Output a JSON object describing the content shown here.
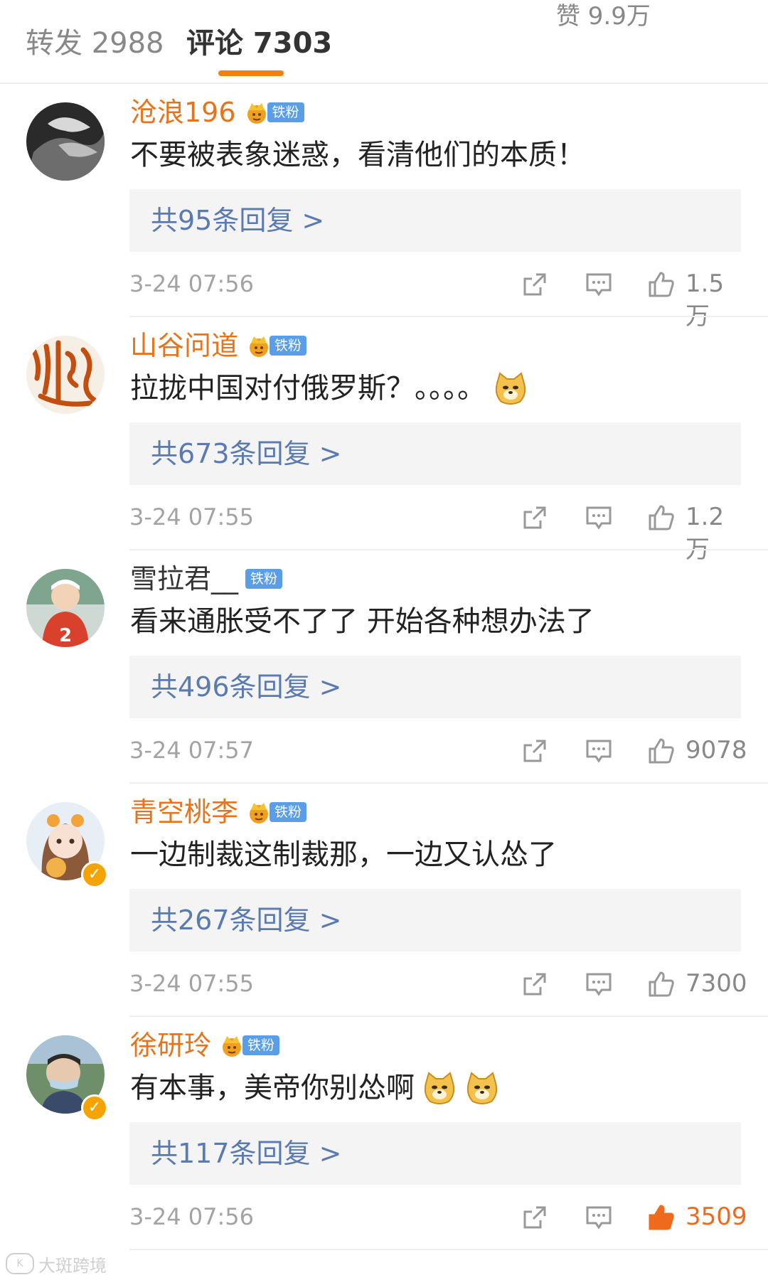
{
  "tabs": {
    "repost": "转发 2988",
    "comments": "评论 7303",
    "likes": "赞 9.9万"
  },
  "colors": {
    "accent": "#f2810c",
    "username": "#e8731a",
    "reply_link": "#5a7ab0",
    "fan_badge": "#5b9ee8",
    "liked": "#f06a1e"
  },
  "icons": {
    "share": "share-icon",
    "reply": "comment-icon",
    "like": "thumbs-up-icon",
    "crown": "crown-icon",
    "doge": "doge-emoji",
    "verified": "verified-icon"
  },
  "comments": [
    {
      "username": "沧浪196",
      "badge": "铁粉",
      "text": "不要被表象迷惑，看清他们的本质！",
      "replies": "共95条回复 >",
      "time": "3-24 07:56",
      "likes": "1.5万"
    },
    {
      "username": "山谷问道",
      "badge": "铁粉",
      "text": "拉拢中国对付俄罗斯？。。。。",
      "replies": "共673条回复 >",
      "time": "3-24 07:55",
      "likes": "1.2万"
    },
    {
      "username": "雪拉君__",
      "badge": "铁粉",
      "text": "看来通胀受不了了 开始各种想办法了",
      "replies": "共496条回复 >",
      "time": "3-24 07:57",
      "likes": "9078"
    },
    {
      "username": "青空桃李",
      "badge": "铁粉",
      "text": "一边制裁这制裁那，一边又认怂了",
      "replies": "共267条回复 >",
      "time": "3-24 07:55",
      "likes": "7300"
    },
    {
      "username": "徐研玲",
      "badge": "铁粉",
      "text": "有本事，美帝你别怂啊",
      "replies": "共117条回复 >",
      "time": "3-24 07:56",
      "likes": "3509"
    }
  ],
  "watermark": {
    "logo": "K",
    "text": "大斑跨境"
  }
}
